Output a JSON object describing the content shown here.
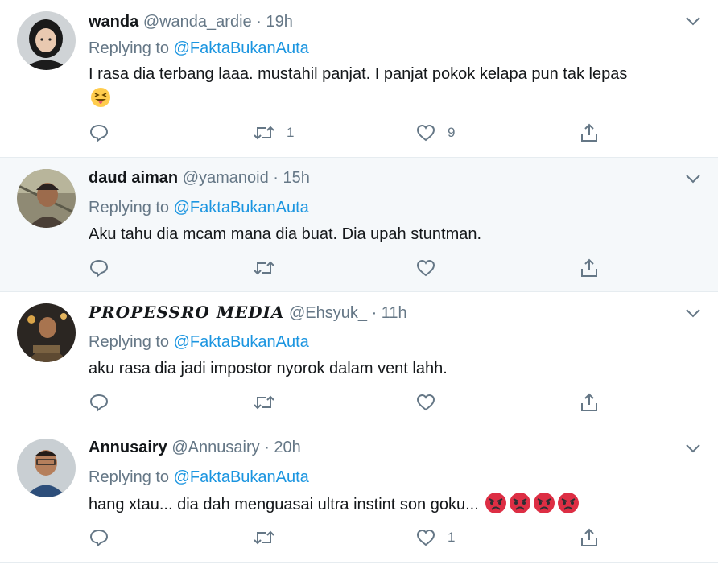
{
  "colors": {
    "text_primary": "#14171a",
    "text_secondary": "#657786",
    "link": "#1b95e0",
    "divider": "#e6ecf0",
    "hover_bg": "#f5f8fa"
  },
  "tweets": [
    {
      "name": "wanda",
      "handle": "@wanda_ardie",
      "separator": "·",
      "time": "19h",
      "replying_prefix": "Replying to",
      "replying_to": "@FaktaBukanAuta",
      "text": "I rasa dia terbang laaa. mustahil panjat. I panjat pokok kelapa pun tak lepas",
      "emoji": "squinting-face-with-tongue",
      "reply_count": "",
      "retweet_count": "1",
      "like_count": "9"
    },
    {
      "name": "daud aiman",
      "handle": "@yamanoid",
      "separator": "·",
      "time": "15h",
      "replying_prefix": "Replying to",
      "replying_to": "@FaktaBukanAuta",
      "text": "Aku tahu dia mcam mana dia buat. Dia upah stuntman.",
      "reply_count": "",
      "retweet_count": "",
      "like_count": ""
    },
    {
      "name": "PROPESSRO MEDIA",
      "handle": "@Ehsyuk_",
      "separator": "·",
      "time": "11h",
      "replying_prefix": "Replying to",
      "replying_to": "@FaktaBukanAuta",
      "text": "aku rasa dia jadi impostor nyorok dalam vent lahh.",
      "reply_count": "",
      "retweet_count": "",
      "like_count": ""
    },
    {
      "name": "Annusairy",
      "handle": "@Annusairy",
      "separator": "·",
      "time": "20h",
      "replying_prefix": "Replying to",
      "replying_to": "@FaktaBukanAuta",
      "text": "hang xtau... dia dah menguasai ultra instint son goku...",
      "emoji": "pouting-face x4",
      "reply_count": "",
      "retweet_count": "",
      "like_count": "1"
    }
  ]
}
